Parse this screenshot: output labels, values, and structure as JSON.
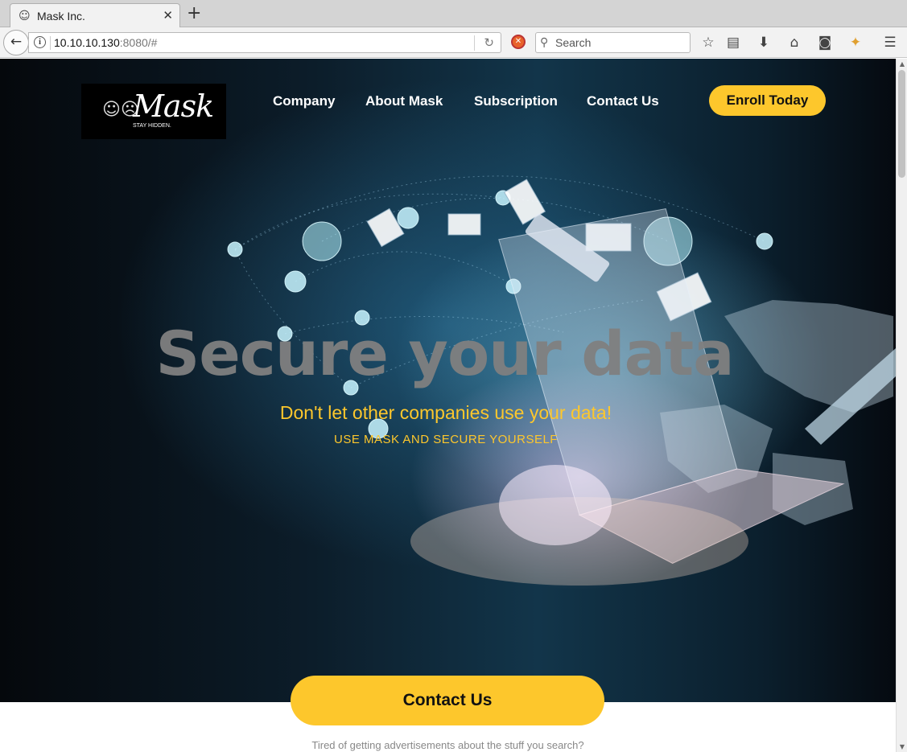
{
  "browser": {
    "tab_title": "Mask Inc.",
    "url_host": "10.10.10.130",
    "url_rest": ":8080/#",
    "search_placeholder": "Search"
  },
  "site": {
    "logo_word": "Mask",
    "logo_tagline": "STAY HIDDEN.",
    "nav": [
      "Company",
      "About Mask",
      "Subscription",
      "Contact Us"
    ],
    "enroll_label": "Enroll Today",
    "headline": "Secure your data",
    "subheadline": "Don't let other companies use your data!",
    "subheadline2": "USE MASK AND SECURE YOURSELF",
    "contact_label": "Contact Us",
    "tagline": "Tired of getting advertisements about the stuff you search?"
  },
  "colors": {
    "accent": "#fdc72c",
    "headline": "#808080"
  },
  "icons": [
    "back-arrow-icon",
    "info-icon",
    "reload-icon",
    "noscript-icon",
    "search-icon",
    "bookmark-star-icon",
    "reading-list-icon",
    "download-icon",
    "home-icon",
    "pocket-icon",
    "extension-icon",
    "hamburger-menu-icon",
    "theater-masks-icon"
  ]
}
